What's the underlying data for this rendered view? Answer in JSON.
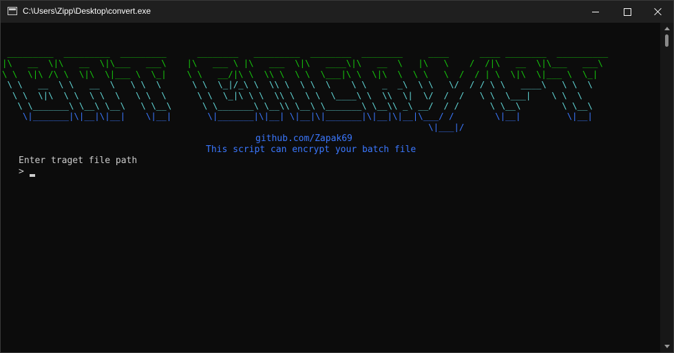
{
  "window": {
    "title": "C:\\Users\\Zipp\\Desktop\\convert.exe",
    "icons": {
      "app": "console-app-icon",
      "minimize": "minimize-icon",
      "maximize": "maximize-icon",
      "close": "close-icon"
    }
  },
  "console": {
    "banner_lines": [
      " _________  _________  _________      ________   _________  ________  ________     ____      ____ ________  __________",
      "|\\   __  \\|\\   __  \\|\\___   ___\\    |\\   ___ \\ |\\   ___  \\|\\   ____\\|\\   __  \\   |\\   \\    /  /|\\   __  \\|\\___   ___\\",
      "\\ \\  \\|\\ /\\ \\  \\|\\  \\|___ \\  \\_|    \\ \\   __/|\\ \\  \\\\ \\  \\ \\  \\___|\\ \\  \\|\\  \\  \\ \\   \\  /  / | \\  \\|\\  \\|___ \\  \\_|",
      " \\ \\   __  \\ \\   __  \\   \\ \\  \\      \\ \\  \\_|/_\\ \\  \\\\ \\  \\ \\  \\    \\ \\   _  _\\  \\ \\   \\/  / / \\ \\   ____\\   \\ \\  \\",
      "  \\ \\  \\|\\  \\ \\  \\ \\  \\   \\ \\  \\      \\ \\  \\_|\\ \\ \\  \\\\ \\  \\ \\  \\____\\ \\  \\\\  \\|  \\/  /  /   \\ \\  \\___|    \\ \\  \\",
      "   \\ \\_______\\ \\__\\ \\__\\   \\ \\__\\      \\ \\_______\\ \\__\\\\ \\__\\ \\_______\\ \\__\\\\ _\\ __/  / /      \\ \\__\\        \\ \\__\\",
      "    \\|_______|\\|__|\\|__|    \\|__|       \\|_______|\\|__| \\|__|\\|_______|\\|__|\\|__|\\___/ /        \\|__|         \\|__|",
      "                                                                                   \\|___|/"
    ],
    "github": "github.com/Zapak69",
    "description": "This script can encrypt your batch file",
    "prompt_label": "Enter traget file path",
    "prompt_caret": ">",
    "input_value": ""
  },
  "colors": {
    "background": "#0c0c0c",
    "titlebar": "#1f1f1f",
    "banner_green": "#16c60c",
    "banner_blue": "#3b78ff",
    "banner_cyan": "#61d6d6",
    "text": "#cccccc"
  }
}
